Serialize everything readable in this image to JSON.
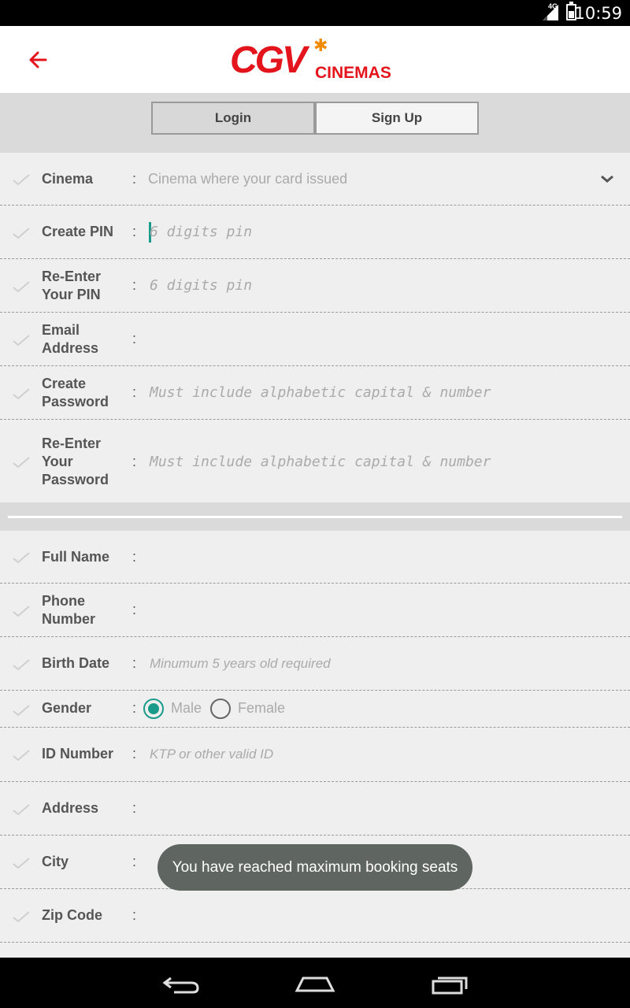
{
  "status": {
    "network": "4G",
    "time": "10:59"
  },
  "header": {
    "brand": "CGV",
    "brand_suffix": "CINEMAS"
  },
  "tabs": {
    "login": "Login",
    "signup": "Sign Up"
  },
  "form1": {
    "cinema": {
      "label": "Cinema",
      "placeholder": "Cinema where your card issued"
    },
    "pin": {
      "label": "Create PIN",
      "placeholder": "6 digits pin"
    },
    "repin": {
      "label1": "Re-Enter",
      "label2": "Your PIN",
      "placeholder": "6 digits pin"
    },
    "email": {
      "label1": "Email",
      "label2": "Address"
    },
    "password": {
      "label1": "Create",
      "label2": "Password",
      "placeholder": "Must include alphabetic capital & number"
    },
    "repassword": {
      "label1": "Re-Enter",
      "label2": "Your",
      "label3": "Password",
      "placeholder": "Must include alphabetic capital & number"
    }
  },
  "form2": {
    "fullname": {
      "label": "Full Name"
    },
    "phone": {
      "label1": "Phone",
      "label2": "Number"
    },
    "birth": {
      "label": "Birth Date",
      "placeholder": "Minumum 5 years old required"
    },
    "gender": {
      "label": "Gender",
      "male": "Male",
      "female": "Female",
      "selected": "Male"
    },
    "id": {
      "label": "ID Number",
      "placeholder": "KTP or other valid ID"
    },
    "address": {
      "label": "Address"
    },
    "city": {
      "label": "City"
    },
    "zip": {
      "label": "Zip Code"
    }
  },
  "colon": ":",
  "toast": "You have reached maximum booking seats",
  "colors": {
    "brand": "#e3141b",
    "accent": "#1a9b8a",
    "toast_bg": "#5f6661"
  },
  "icons": [
    "back-arrow-icon",
    "check-icon",
    "chevron-down-icon",
    "back-nav-icon",
    "home-nav-icon",
    "recents-nav-icon"
  ]
}
